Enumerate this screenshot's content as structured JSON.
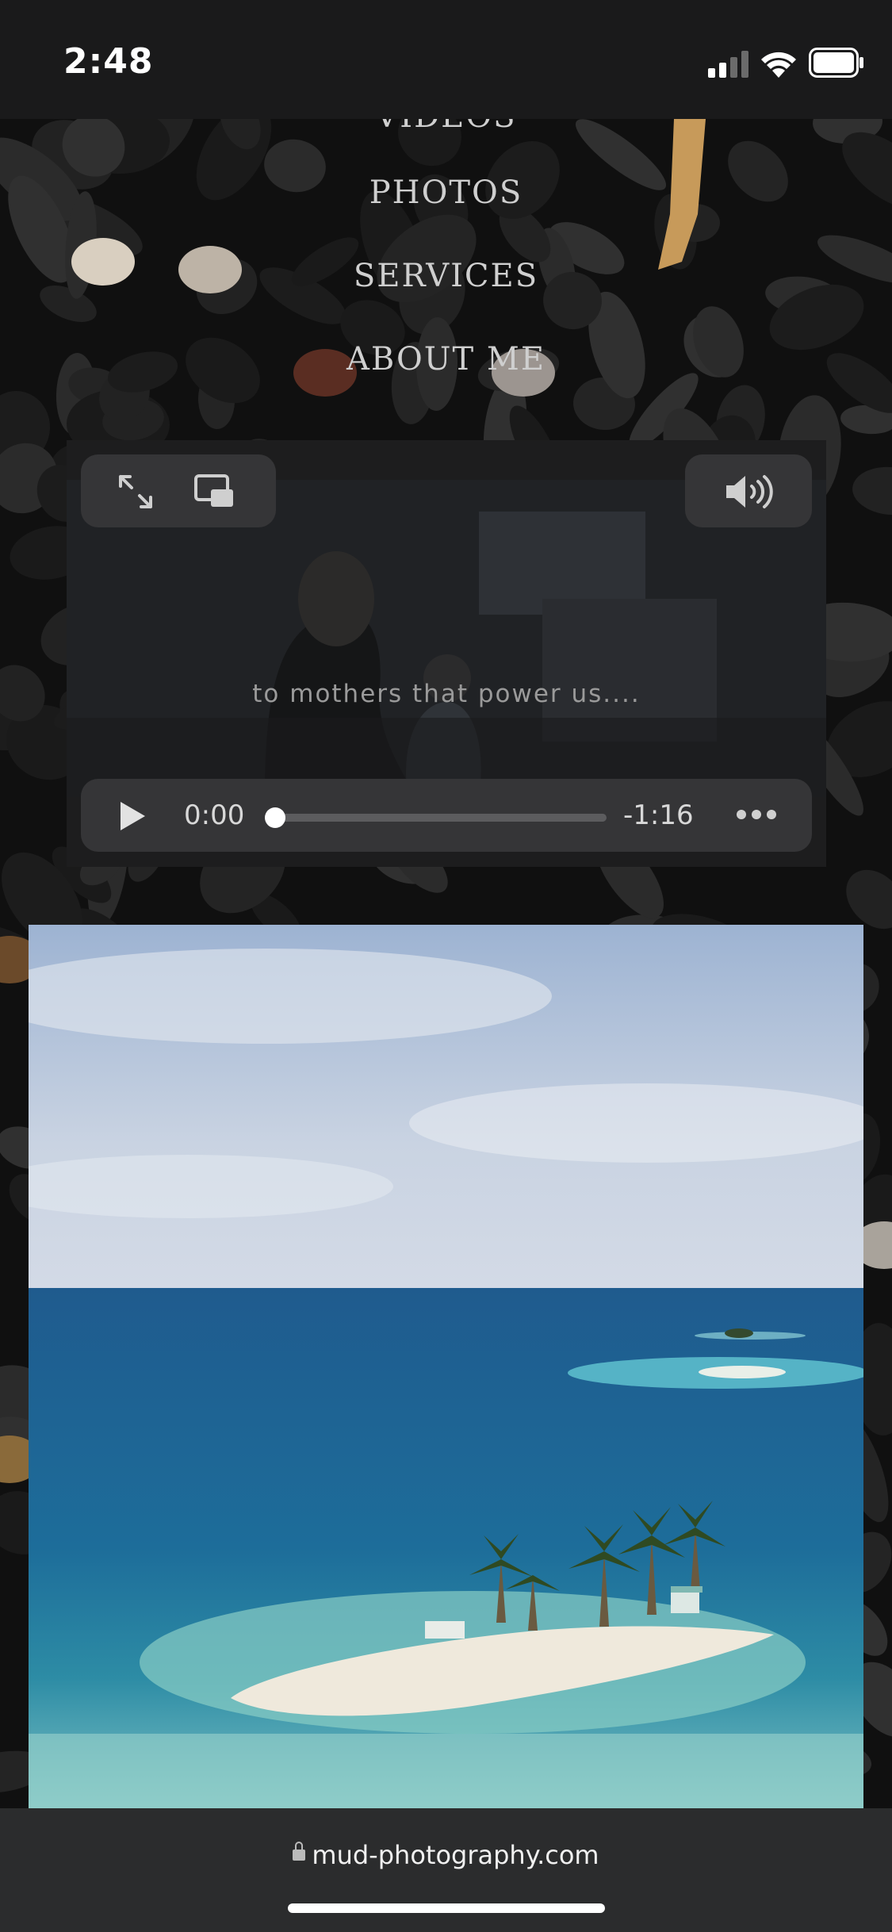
{
  "status_bar": {
    "time": "2:48"
  },
  "menu": {
    "items": [
      "VIDEOS",
      "PHOTOS",
      "SERVICES",
      "ABOUT ME"
    ]
  },
  "video": {
    "caption": "to mothers that power us....",
    "current_time": "0:00",
    "remaining_time": "-1:16",
    "progress": 0
  },
  "browser": {
    "url": "mud-photography.com"
  },
  "icons": {
    "fullscreen": "fullscreen-icon",
    "pip": "picture-in-picture-icon",
    "volume": "volume-icon",
    "play": "play-icon",
    "more": "more-icon",
    "lock": "lock-icon"
  }
}
